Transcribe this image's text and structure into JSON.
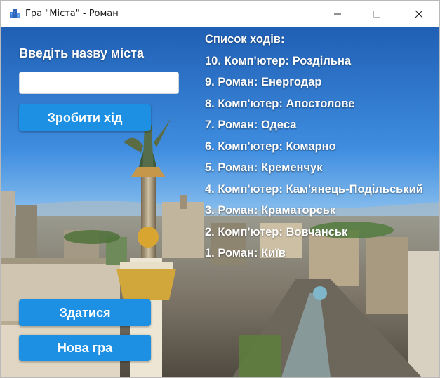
{
  "window": {
    "title": "Гра \"Міста\" - Роман",
    "controls": [
      "minimize-icon",
      "maximize-icon",
      "close-icon"
    ]
  },
  "form": {
    "label": "Введіть назву міста",
    "input_value": "",
    "make_move_button": "Зробити хід"
  },
  "moves": {
    "title": "Список ходів:",
    "items": [
      "10. Комп'ютер: Роздільна",
      "9. Роман: Енергодар",
      "8. Комп'ютер: Апостолове",
      "7. Роман: Одеса",
      "6. Комп'ютер: Комарно",
      "5. Роман: Кременчук",
      "4. Комп'ютер: Кам'янець-Подільський",
      "3. Роман: Краматорськ",
      "2. Комп'ютер: Вовчанськ",
      "1. Роман: Київ"
    ]
  },
  "actions": {
    "give_up_button": "Здатися",
    "new_game_button": "Нова гра"
  },
  "colors": {
    "accent": "#1e90e3",
    "titlebar": "#ffffff",
    "text_on_image": "#ffffff"
  }
}
